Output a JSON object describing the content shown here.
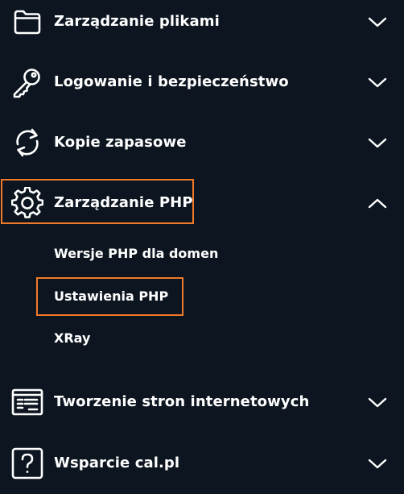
{
  "menu": {
    "items": [
      {
        "label": "Zarządzanie plikami",
        "icon": "folder-icon",
        "chevron": "chevron-down-icon"
      },
      {
        "label": "Logowanie i bezpieczeństwo",
        "icon": "key-icon",
        "chevron": "chevron-down-icon"
      },
      {
        "label": "Kopie zapasowe",
        "icon": "refresh-icon",
        "chevron": "chevron-down-icon"
      },
      {
        "label": "Zarządzanie PHP",
        "icon": "gear-icon",
        "chevron": "chevron-up-icon",
        "expanded": true,
        "submenu": [
          {
            "label": "Wersje PHP dla domen"
          },
          {
            "label": "Ustawienia PHP",
            "highlighted": true
          },
          {
            "label": "XRay"
          }
        ]
      },
      {
        "label": "Tworzenie stron internetowych",
        "icon": "website-builder-icon",
        "chevron": "chevron-down-icon"
      },
      {
        "label": "Wsparcie cal.pl",
        "icon": "help-icon",
        "chevron": "chevron-down-icon"
      }
    ]
  },
  "colors": {
    "background": "#0d1620",
    "text": "#ffffff",
    "highlight": "#f07a2a"
  }
}
